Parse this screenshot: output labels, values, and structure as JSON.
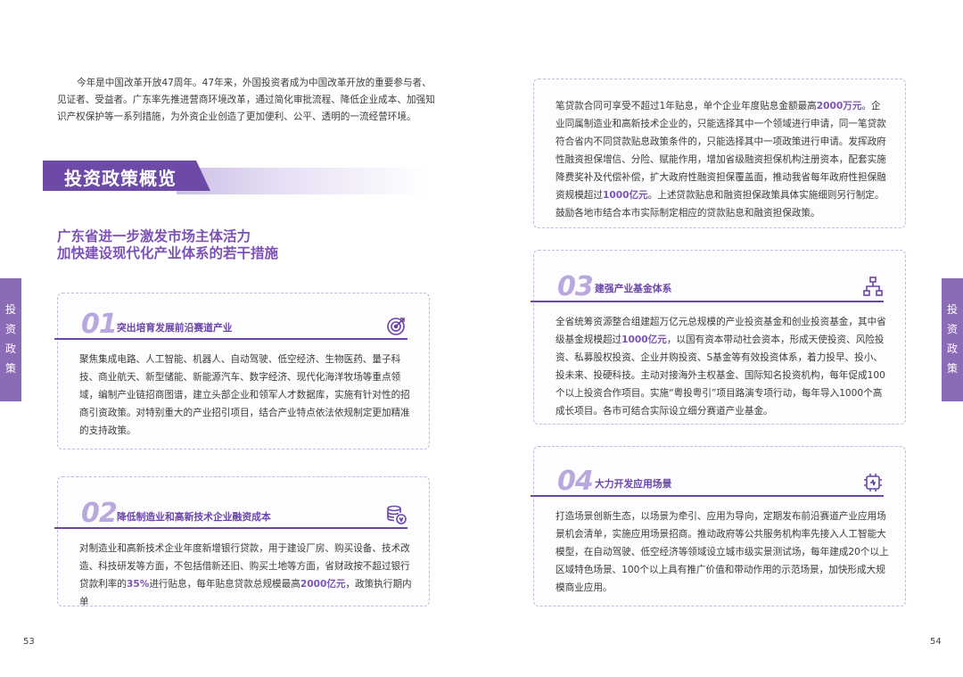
{
  "intro": "今年是中国改革开放47周年。47年来，外国投资者成为中国改革开放的重要参与者、见证者、受益者。广东率先推进营商环境改革，通过简化审批流程、降低企业成本、加强知识产权保护等一系列措施，为外资企业创造了更加便利、公平、透明的一流经营环境。",
  "section_title": "投资政策概览",
  "subtitle_line1": "广东省进一步激发市场主体活力",
  "subtitle_line2": "加快建设现代化产业体系的若干措施",
  "side_tab": [
    "投",
    "资",
    "政",
    "策"
  ],
  "page_left": "53",
  "page_right": "54",
  "cards": {
    "c1": {
      "num": "01",
      "title": "突出培育发展前沿赛道产业",
      "icon": "target-icon",
      "body": "聚焦集成电路、人工智能、机器人、自动驾驶、低空经济、生物医药、量子科技、商业航天、新型储能、新能源汽车、数字经济、现代化海洋牧场等重点领域，编制产业链招商图谱，建立头部企业和领军人才数据库，实施有针对性的招商引资政策。对特别重大的产业招引项目，结合产业特点依法依规制定更加精准的支持政策。"
    },
    "c2": {
      "num": "02",
      "title": "降低制造业和高新技术企业融资成本",
      "icon": "coins-icon",
      "body_a": "对制造业和高新技术企业年度新增银行贷款，用于建设厂房、购买设备、技术改造、科技研发等方面，不包括借新还旧、购买土地等方面，省财政按不超过银行贷款利率的",
      "body_hl1": "35%",
      "body_b": "进行贴息，每年贴息贷款总规模最高",
      "body_hl2": "2000亿元",
      "body_c": "，政策执行期内单"
    },
    "c2cont": {
      "body_a": "笔贷款合同可享受不超过1年贴息，单个企业年度贴息金额最高",
      "body_hl1": "2000万元",
      "body_b": "。企业同属制造业和高新技术企业的，只能选择其中一个领域进行申请，同一笔贷款符合省内不同贷款贴息政策条件的，只能选择其中一项政策进行申请。发挥政府性融资担保增信、分险、赋能作用，增加省级融资担保机构注册资本，配套实施降费奖补及代偿补偿，扩大政府性融资担保覆盖面，推动我省每年政府性担保融资规模超过",
      "body_hl2": "1000亿元",
      "body_c": "。上述贷款贴息和融资担保政策具体实施细则另行制定。鼓励各地市结合本市实际制定相应的贷款贴息和融资担保政策。"
    },
    "c3": {
      "num": "03",
      "title": "建强产业基金体系",
      "icon": "org-chart-icon",
      "body_a": "全省统筹资源整合组建超万亿元总规模的产业投资基金和创业投资基金，其中省级基金规模超过",
      "body_hl1": "1000亿元",
      "body_b": "，以国有资本带动社会资本，形成天使投资、风险投资、私募股权投资、企业并购投资、S基金等有效投资体系，着力投早、投小、投未来、投硬科技。主动对接海外主权基金、国际知名投资机构，每年促成100个以上投资合作项目。实施“粤投粤引”项目路演专项行动，每年导入1000个高成长项目。各市可结合实际设立细分赛道产业基金。"
    },
    "c4": {
      "num": "04",
      "title": "大力开发应用场景",
      "icon": "chip-icon",
      "body": "打造场景创新生态，以场景为牵引、应用为导向，定期发布前沿赛道产业应用场景机会清单，实施应用场景招商。推动政府等公共服务机构率先接入人工智能大模型，在自动驾驶、低空经济等领域设立城市级实景测试场，每年建成20个以上区域特色场景、100个以上具有推广价值和带动作用的示范场景，加快形成大规模商业应用。"
    }
  },
  "colors": {
    "accent": "#6b45a8",
    "light": "#b9a8dd",
    "tab": "#8a6cb6"
  }
}
